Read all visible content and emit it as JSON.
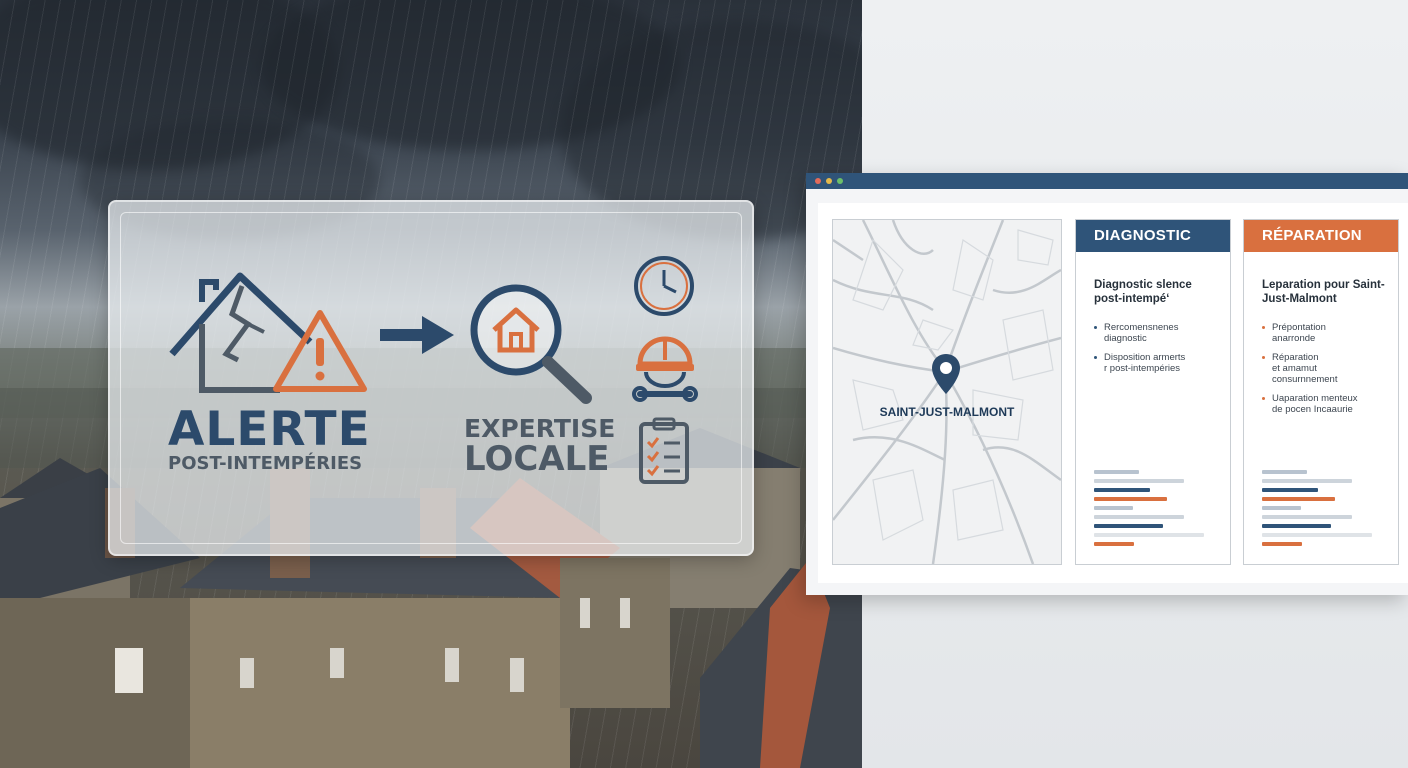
{
  "hero": {
    "alert_title": "ALERTE",
    "alert_subtitle": "POST-INTEMPÉRIES",
    "expertise_line1": "EXPERTISE",
    "expertise_line2": "LOCALE"
  },
  "icons": {
    "damaged_house": "house-crack-icon",
    "warning": "warning-triangle-icon",
    "arrow": "arrow-right-icon",
    "inspection": "magnifier-house-icon",
    "clock": "clock-icon",
    "worker": "hard-hat-wrench-icon",
    "checklist": "clipboard-checklist-icon"
  },
  "colors": {
    "navy": "#2c4a6b",
    "orange": "#d9703f",
    "chrome_bar": "#2f5479",
    "diagnostic_header": "#2f5479",
    "reparation_header": "#d9703f"
  },
  "browser": {
    "map_label": "SAINT-JUST-MALMONT",
    "diagnostic": {
      "header": "DIAGNOSTIC",
      "title": "Diagnostic slence post-intempé‘",
      "items": [
        "Rer­comensnenes\ndiagnostic",
        "Disposition armerts\nr post-intempéries"
      ]
    },
    "reparation": {
      "header": "RÉPARATION",
      "title": "Leparation pour Saint-Just-Malmont",
      "items": [
        "Prépontation\nanarronde",
        "Réparation\net amamut\nconsurnnement",
        "Uaparation menteux\nde pocen Incaaurie"
      ]
    },
    "summary_bars": [
      {
        "level": 0.4,
        "color": "#b8c3cf"
      },
      {
        "level": 0.8,
        "color": "#cdd4db"
      },
      {
        "level": 0.5,
        "color": "#2f5479"
      },
      {
        "level": 0.65,
        "color": "#d9703f"
      },
      {
        "level": 0.35,
        "color": "#b8c3cf"
      },
      {
        "level": 0.8,
        "color": "#cdd4db"
      },
      {
        "level": 0.62,
        "color": "#2f5479"
      },
      {
        "level": 0.98,
        "color": "#dfe3e7"
      },
      {
        "level": 0.36,
        "color": "#d9703f"
      }
    ]
  }
}
